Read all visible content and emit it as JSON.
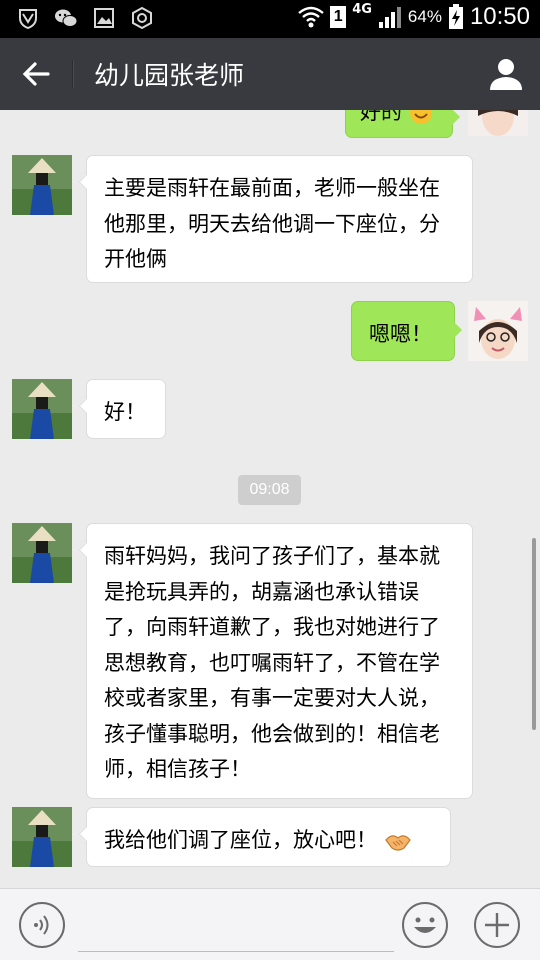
{
  "status_bar": {
    "network_label": "4G",
    "sim_label": "1",
    "battery_percent": "64%",
    "time": "10:50",
    "left_icons": [
      "vpn-shield-icon",
      "wechat-icon",
      "gallery-icon",
      "settings-hex-icon"
    ],
    "right_icons": [
      "wifi-icon",
      "signal-bars-icon",
      "battery-charging-icon"
    ]
  },
  "header": {
    "title": "幼儿园张老师",
    "back_icon": "back-arrow-icon",
    "profile_icon": "person-icon",
    "background": "#393a3f"
  },
  "chat": {
    "messages": [
      {
        "side": "right",
        "text": "好的",
        "emoji": "smile-emoji",
        "partial": true
      },
      {
        "side": "left",
        "text": "主要是雨轩在最前面，老师一般坐在他那里，明天去给他调一下座位，分开他俩"
      },
      {
        "side": "right",
        "text": "嗯嗯！"
      },
      {
        "side": "left",
        "text": "好！"
      },
      {
        "side": "left",
        "text": "雨轩妈妈，我问了孩子们了，基本就是抢玩具弄的，胡嘉涵也承认错误了，向雨轩道歉了，我也对她进行了思想教育，也叮嘱雨轩了，不管在学校或者家里，有事一定要对大人说，孩子懂事聪明，他会做到的！相信老师，相信孩子！"
      },
      {
        "side": "left",
        "text": "我给他们调了座位，放心吧！",
        "emoji": "handshake-emoji"
      }
    ],
    "timestamp": "09:08",
    "colors": {
      "sent_bubble": "#9fe658",
      "received_bubble": "#ffffff",
      "background": "#ebebeb"
    }
  },
  "input_bar": {
    "voice_icon": "voice-icon",
    "emoji_icon": "emoji-face-icon",
    "plus_icon": "plus-icon",
    "text_value": ""
  }
}
